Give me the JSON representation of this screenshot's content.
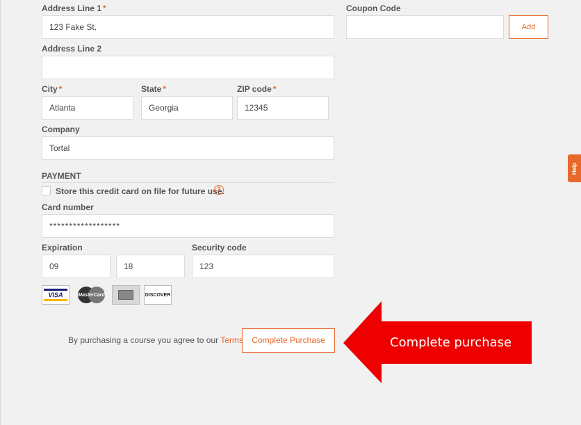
{
  "address": {
    "line1_label": "Address Line 1",
    "line1_required": "*",
    "line1_value": "123 Fake St.",
    "line2_label": "Address Line 2",
    "line2_value": "",
    "city_label": "City",
    "city_value": "Atlanta",
    "state_label": "State",
    "state_value": "Georgia",
    "zip_label": "ZIP code",
    "zip_value": "12345",
    "company_label": "Company",
    "company_value": "Tortal",
    "required_mark": "*"
  },
  "coupon": {
    "label": "Coupon Code",
    "value": "",
    "add_label": "Add"
  },
  "payment": {
    "title": "PAYMENT",
    "store_card_label": "Store this credit card on file for future use.",
    "store_card_checked": false,
    "card_number_label": "Card number",
    "card_number_value": "******************",
    "expiration_label": "Expiration",
    "exp_month": "09",
    "exp_year": "18",
    "security_code_label": "Security code",
    "security_code_value": "123",
    "card_logos": [
      {
        "name": "visa",
        "text": "VISA"
      },
      {
        "name": "mastercard",
        "text": "MasterCard"
      },
      {
        "name": "amex",
        "text": ""
      },
      {
        "name": "discover",
        "text": "DISCOVER"
      }
    ]
  },
  "footer": {
    "agree_text": "By purchasing a course you agree to our",
    "terms_link": "Terms.",
    "complete_button": "Complete Purchase"
  },
  "annotation": {
    "arrow_text": "Complete purchase",
    "arrow_color": "#ee0000"
  },
  "help_tab": {
    "label": "Help"
  },
  "colors": {
    "accent": "#e8692c",
    "background": "#f1f1f1"
  }
}
